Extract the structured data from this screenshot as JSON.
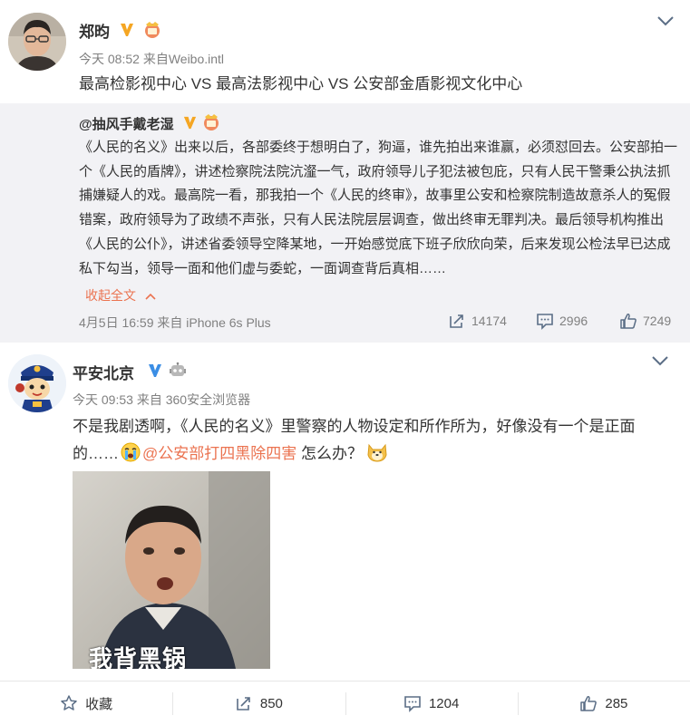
{
  "post1": {
    "username": "郑昀",
    "time": "今天 08:52",
    "source_prefix": "来自",
    "source": "Weibo.intl",
    "text": "最高检影视中心 VS 最高法影视中心 VS 公安部金盾影视文化中心",
    "repost": {
      "username": "@抽风手戴老湿",
      "text": "《人民的名义》出来以后，各部委终于想明白了，狗逼，谁先拍出来谁赢，必须怼回去。公安部拍一个《人民的盾牌》，讲述检察院法院沆瀣一气，政府领导儿子犯法被包庇，只有人民干警秉公执法抓捕嫌疑人的戏。最高院一看，那我拍一个《人民的终审》，故事里公安和检察院制造故意杀人的冤假错案，政府领导为了政绩不声张，只有人民法院层层调查，做出终审无罪判决。最后领导机构推出《人民的公仆》，讲述省委领导空降某地，一开始感觉底下班子欣欣向荣，后来发现公检法早已达成私下勾当，领导一面和他们虚与委蛇，一面调查背后真相……",
      "collapse_label": "收起全文",
      "time": "4月5日 16:59",
      "source_prefix": "来自",
      "source": "iPhone 6s Plus",
      "reposts": "14174",
      "comments": "2996",
      "likes": "7249"
    }
  },
  "post2": {
    "username": "平安北京",
    "time": "今天 09:53",
    "source_prefix": "来自",
    "source": "360安全浏览器",
    "text_part1": "不是我剧透啊，《人民的名义》里警察的人物设定和所作所为，好像没有一个是正面的……",
    "mention": "@公安部打四黑除四害",
    "text_part2": " 怎么办？",
    "photo_caption": "我背黑锅"
  },
  "bottom_bar": {
    "favorite_label": "收藏",
    "reposts": "850",
    "comments": "1204",
    "likes": "285"
  },
  "colors": {
    "link": "#eb7350",
    "verified": "#f5a623",
    "verified_blue": "#3b8ee5",
    "repost_bg": "#f2f2f5"
  },
  "icons": [
    "verified-badge-icon",
    "medal-icon",
    "chevron-down-icon",
    "repost-icon",
    "comment-icon",
    "like-icon",
    "star-icon",
    "crying-emoji-icon",
    "doge-emoji-icon",
    "robot-icon"
  ]
}
